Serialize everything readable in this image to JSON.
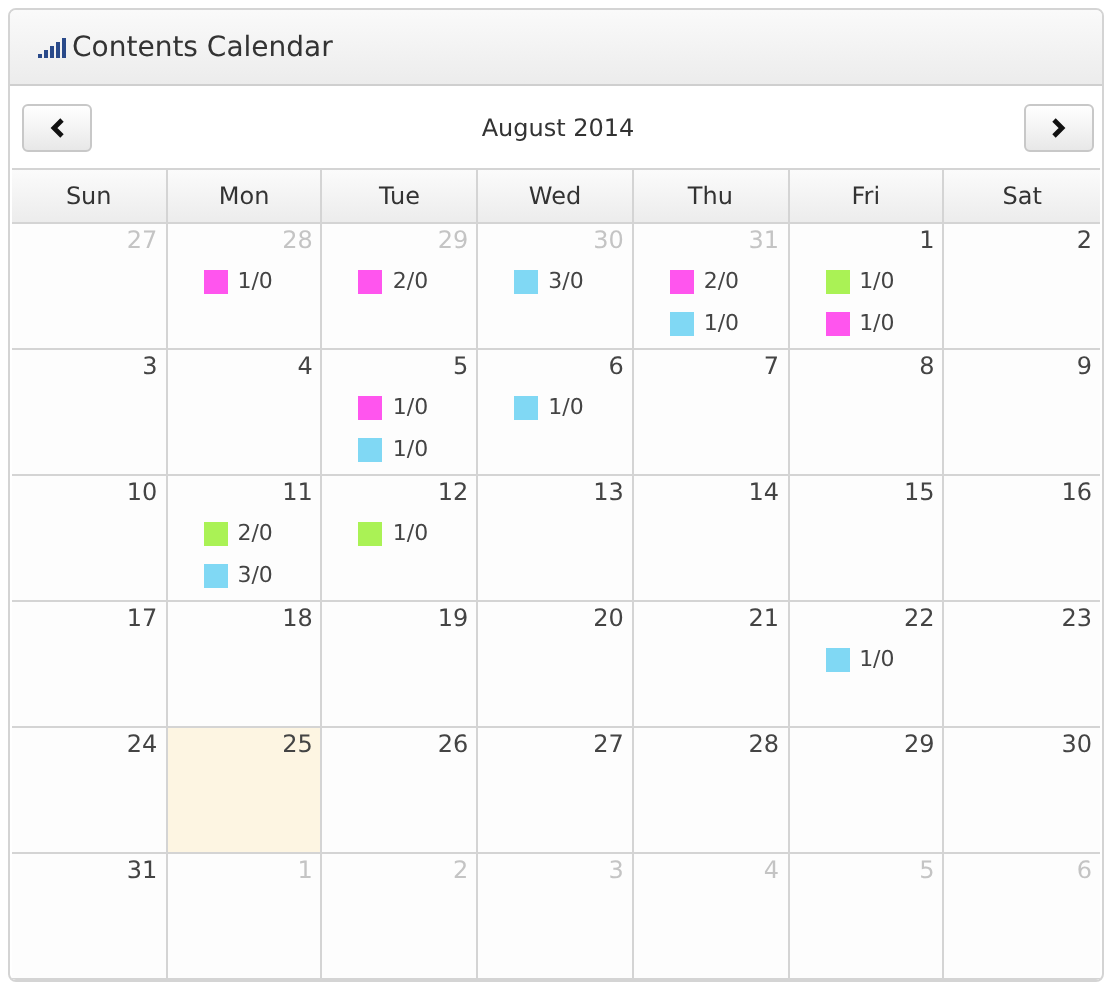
{
  "title": "Contents Calendar",
  "month_label": "August 2014",
  "weekdays": [
    "Sun",
    "Mon",
    "Tue",
    "Wed",
    "Thu",
    "Fri",
    "Sat"
  ],
  "weeks": [
    [
      {
        "day": "27",
        "other_month": true,
        "today": false
      },
      {
        "day": "28",
        "other_month": true,
        "today": false,
        "events": [
          {
            "color": "#ff55ee",
            "label": "1/0"
          }
        ]
      },
      {
        "day": "29",
        "other_month": true,
        "today": false,
        "events": [
          {
            "color": "#ff55ee",
            "label": "2/0"
          }
        ]
      },
      {
        "day": "30",
        "other_month": true,
        "today": false,
        "events": [
          {
            "color": "#80d8f4",
            "label": "3/0"
          }
        ]
      },
      {
        "day": "31",
        "other_month": true,
        "today": false,
        "events": [
          {
            "color": "#ff55ee",
            "label": "2/0"
          },
          {
            "color": "#80d8f4",
            "label": "1/0"
          }
        ]
      },
      {
        "day": "1",
        "other_month": false,
        "today": false,
        "events": [
          {
            "color": "#aaf255",
            "label": "1/0"
          },
          {
            "color": "#ff55ee",
            "label": "1/0"
          }
        ]
      },
      {
        "day": "2",
        "other_month": false,
        "today": false
      }
    ],
    [
      {
        "day": "3",
        "other_month": false,
        "today": false
      },
      {
        "day": "4",
        "other_month": false,
        "today": false
      },
      {
        "day": "5",
        "other_month": false,
        "today": false,
        "events": [
          {
            "color": "#ff55ee",
            "label": "1/0"
          },
          {
            "color": "#80d8f4",
            "label": "1/0"
          }
        ]
      },
      {
        "day": "6",
        "other_month": false,
        "today": false,
        "events": [
          {
            "color": "#80d8f4",
            "label": "1/0"
          }
        ]
      },
      {
        "day": "7",
        "other_month": false,
        "today": false
      },
      {
        "day": "8",
        "other_month": false,
        "today": false
      },
      {
        "day": "9",
        "other_month": false,
        "today": false
      }
    ],
    [
      {
        "day": "10",
        "other_month": false,
        "today": false
      },
      {
        "day": "11",
        "other_month": false,
        "today": false,
        "events": [
          {
            "color": "#aaf255",
            "label": "2/0"
          },
          {
            "color": "#80d8f4",
            "label": "3/0"
          }
        ]
      },
      {
        "day": "12",
        "other_month": false,
        "today": false,
        "events": [
          {
            "color": "#aaf255",
            "label": "1/0"
          }
        ]
      },
      {
        "day": "13",
        "other_month": false,
        "today": false
      },
      {
        "day": "14",
        "other_month": false,
        "today": false
      },
      {
        "day": "15",
        "other_month": false,
        "today": false
      },
      {
        "day": "16",
        "other_month": false,
        "today": false
      }
    ],
    [
      {
        "day": "17",
        "other_month": false,
        "today": false
      },
      {
        "day": "18",
        "other_month": false,
        "today": false
      },
      {
        "day": "19",
        "other_month": false,
        "today": false
      },
      {
        "day": "20",
        "other_month": false,
        "today": false
      },
      {
        "day": "21",
        "other_month": false,
        "today": false
      },
      {
        "day": "22",
        "other_month": false,
        "today": false,
        "events": [
          {
            "color": "#80d8f4",
            "label": "1/0"
          }
        ]
      },
      {
        "day": "23",
        "other_month": false,
        "today": false
      }
    ],
    [
      {
        "day": "24",
        "other_month": false,
        "today": false
      },
      {
        "day": "25",
        "other_month": false,
        "today": true
      },
      {
        "day": "26",
        "other_month": false,
        "today": false
      },
      {
        "day": "27",
        "other_month": false,
        "today": false
      },
      {
        "day": "28",
        "other_month": false,
        "today": false
      },
      {
        "day": "29",
        "other_month": false,
        "today": false
      },
      {
        "day": "30",
        "other_month": false,
        "today": false
      }
    ],
    [
      {
        "day": "31",
        "other_month": false,
        "today": false
      },
      {
        "day": "1",
        "other_month": true,
        "today": false
      },
      {
        "day": "2",
        "other_month": true,
        "today": false
      },
      {
        "day": "3",
        "other_month": true,
        "today": false
      },
      {
        "day": "4",
        "other_month": true,
        "today": false
      },
      {
        "day": "5",
        "other_month": true,
        "today": false
      },
      {
        "day": "6",
        "other_month": true,
        "today": false
      }
    ]
  ]
}
